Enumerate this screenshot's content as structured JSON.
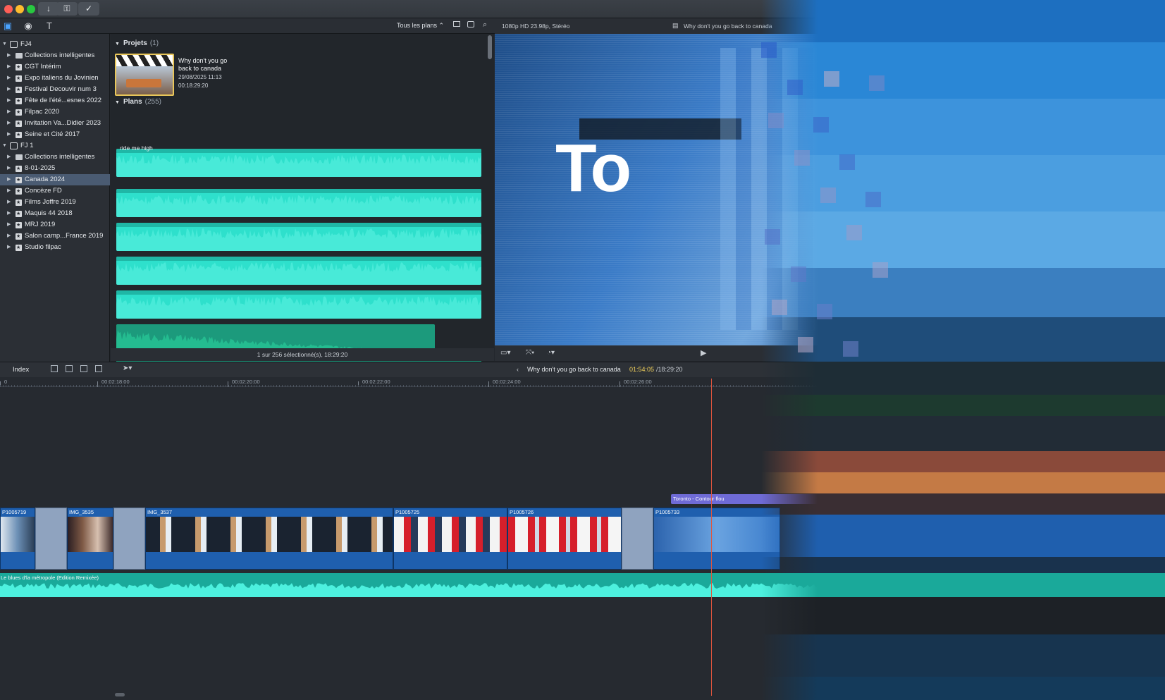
{
  "titlebar": {
    "buttons": [
      "↓",
      "⚿",
      "✓"
    ]
  },
  "toolbar": {
    "filter_label": "Tous les plans ⌃"
  },
  "viewer": {
    "format_label": "1080p HD 23.98p, Stéréo",
    "project_name": "Why don't you go back to canada",
    "overlay_text": "To"
  },
  "sidebar": {
    "items": [
      {
        "label": "FJ4",
        "type": "library"
      },
      {
        "label": "Collections intelligentes",
        "type": "folder"
      },
      {
        "label": "CGT Intérim",
        "type": "event"
      },
      {
        "label": "Expo italiens du Jovinien",
        "type": "event"
      },
      {
        "label": "Festival Decouvir num 3",
        "type": "event"
      },
      {
        "label": "Fête de l'été...esnes 2022",
        "type": "event"
      },
      {
        "label": "Filpac 2020",
        "type": "event"
      },
      {
        "label": "Invitation Va...Didier 2023",
        "type": "event"
      },
      {
        "label": "Seine et Cité 2017",
        "type": "event"
      },
      {
        "label": "FJ 1",
        "type": "library"
      },
      {
        "label": "Collections intelligentes",
        "type": "folder"
      },
      {
        "label": "8-01-2025",
        "type": "event"
      },
      {
        "label": "Canada 2024",
        "type": "event",
        "selected": true
      },
      {
        "label": "Concèze FD",
        "type": "event"
      },
      {
        "label": "Films Joffre 2019",
        "type": "event"
      },
      {
        "label": "Maquis 44 2018",
        "type": "event"
      },
      {
        "label": "MRJ 2019",
        "type": "event"
      },
      {
        "label": "Salon camp...France 2019",
        "type": "event"
      },
      {
        "label": "Studio filpac",
        "type": "event"
      }
    ]
  },
  "browser": {
    "projects_heading": "Projets",
    "projects_count": "(1)",
    "project": {
      "title_line1": "Why don't you go",
      "title_line2": "back to canada",
      "date": "29/08/2025 11:13",
      "duration": "00:18:29:20"
    },
    "plans_heading": "Plans",
    "plans_count": "(255)",
    "first_clip_name": "ride me high",
    "status": "1 sur 256 sélectionné(s), 18:29:20"
  },
  "timeline": {
    "index_label": "Index",
    "project_name": "Why don't you go back to canada",
    "timecode_current": "01:54:05",
    "timecode_total": "/18:29:20",
    "ruler_labels": [
      "0",
      "00:02:18:00",
      "00:02:20:00",
      "00:02:22:00",
      "00:02:24:00",
      "00:02:26:00"
    ],
    "title_clip": "Toronto - Contour flou",
    "clips": [
      "P1005719",
      "IMG_3535",
      "IMG_3537",
      "P1005725",
      "P1005726",
      "P1005733"
    ],
    "audio_clip": "Le blues d'la métropole (Edition Remixée)"
  },
  "colors": {
    "accent": "#4aa3ff",
    "audio_wave": "#2ee0cc",
    "video_clip": "#1f5fae",
    "title_clip": "#6f6bd6",
    "playhead": "#e0553d",
    "selection": "#4a5b72"
  }
}
